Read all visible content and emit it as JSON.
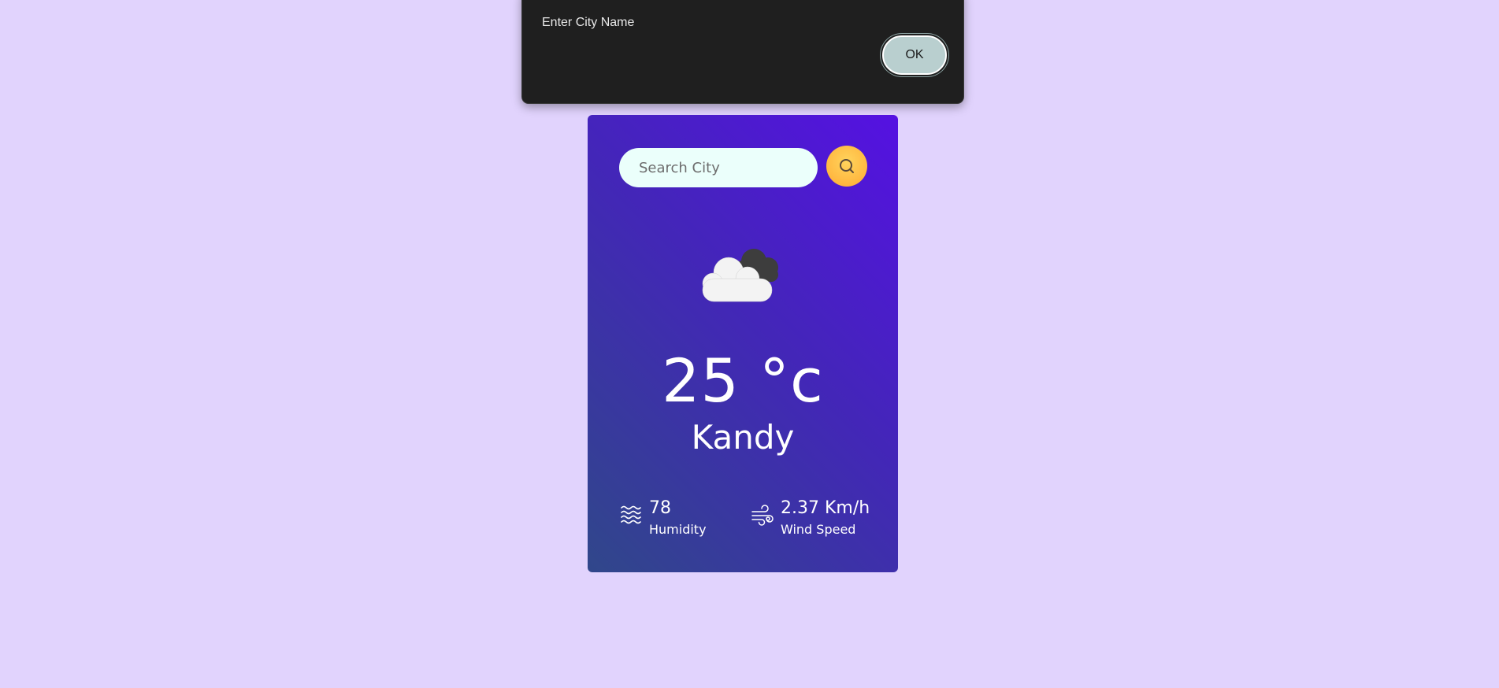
{
  "dialog": {
    "title": "",
    "message": "Enter City Name",
    "ok_label": "OK"
  },
  "search": {
    "placeholder": "Search City",
    "value": "",
    "button_icon": "search-icon"
  },
  "weather": {
    "icon": "clouds-icon",
    "temperature": "25 °c",
    "city": "Kandy",
    "humidity": {
      "icon": "humidity-icon",
      "value": "78",
      "label": "Humidity"
    },
    "wind": {
      "icon": "wind-icon",
      "value": "2.37 Km/h",
      "label": "Wind Speed"
    }
  },
  "colors": {
    "page_background": "#e1d3fd",
    "card_gradient_start": "#5511e2",
    "card_gradient_end": "#30478a",
    "search_button": "#ffc14d",
    "dialog_background": "#1f1f1f",
    "ok_button": "#b9cfcf"
  }
}
